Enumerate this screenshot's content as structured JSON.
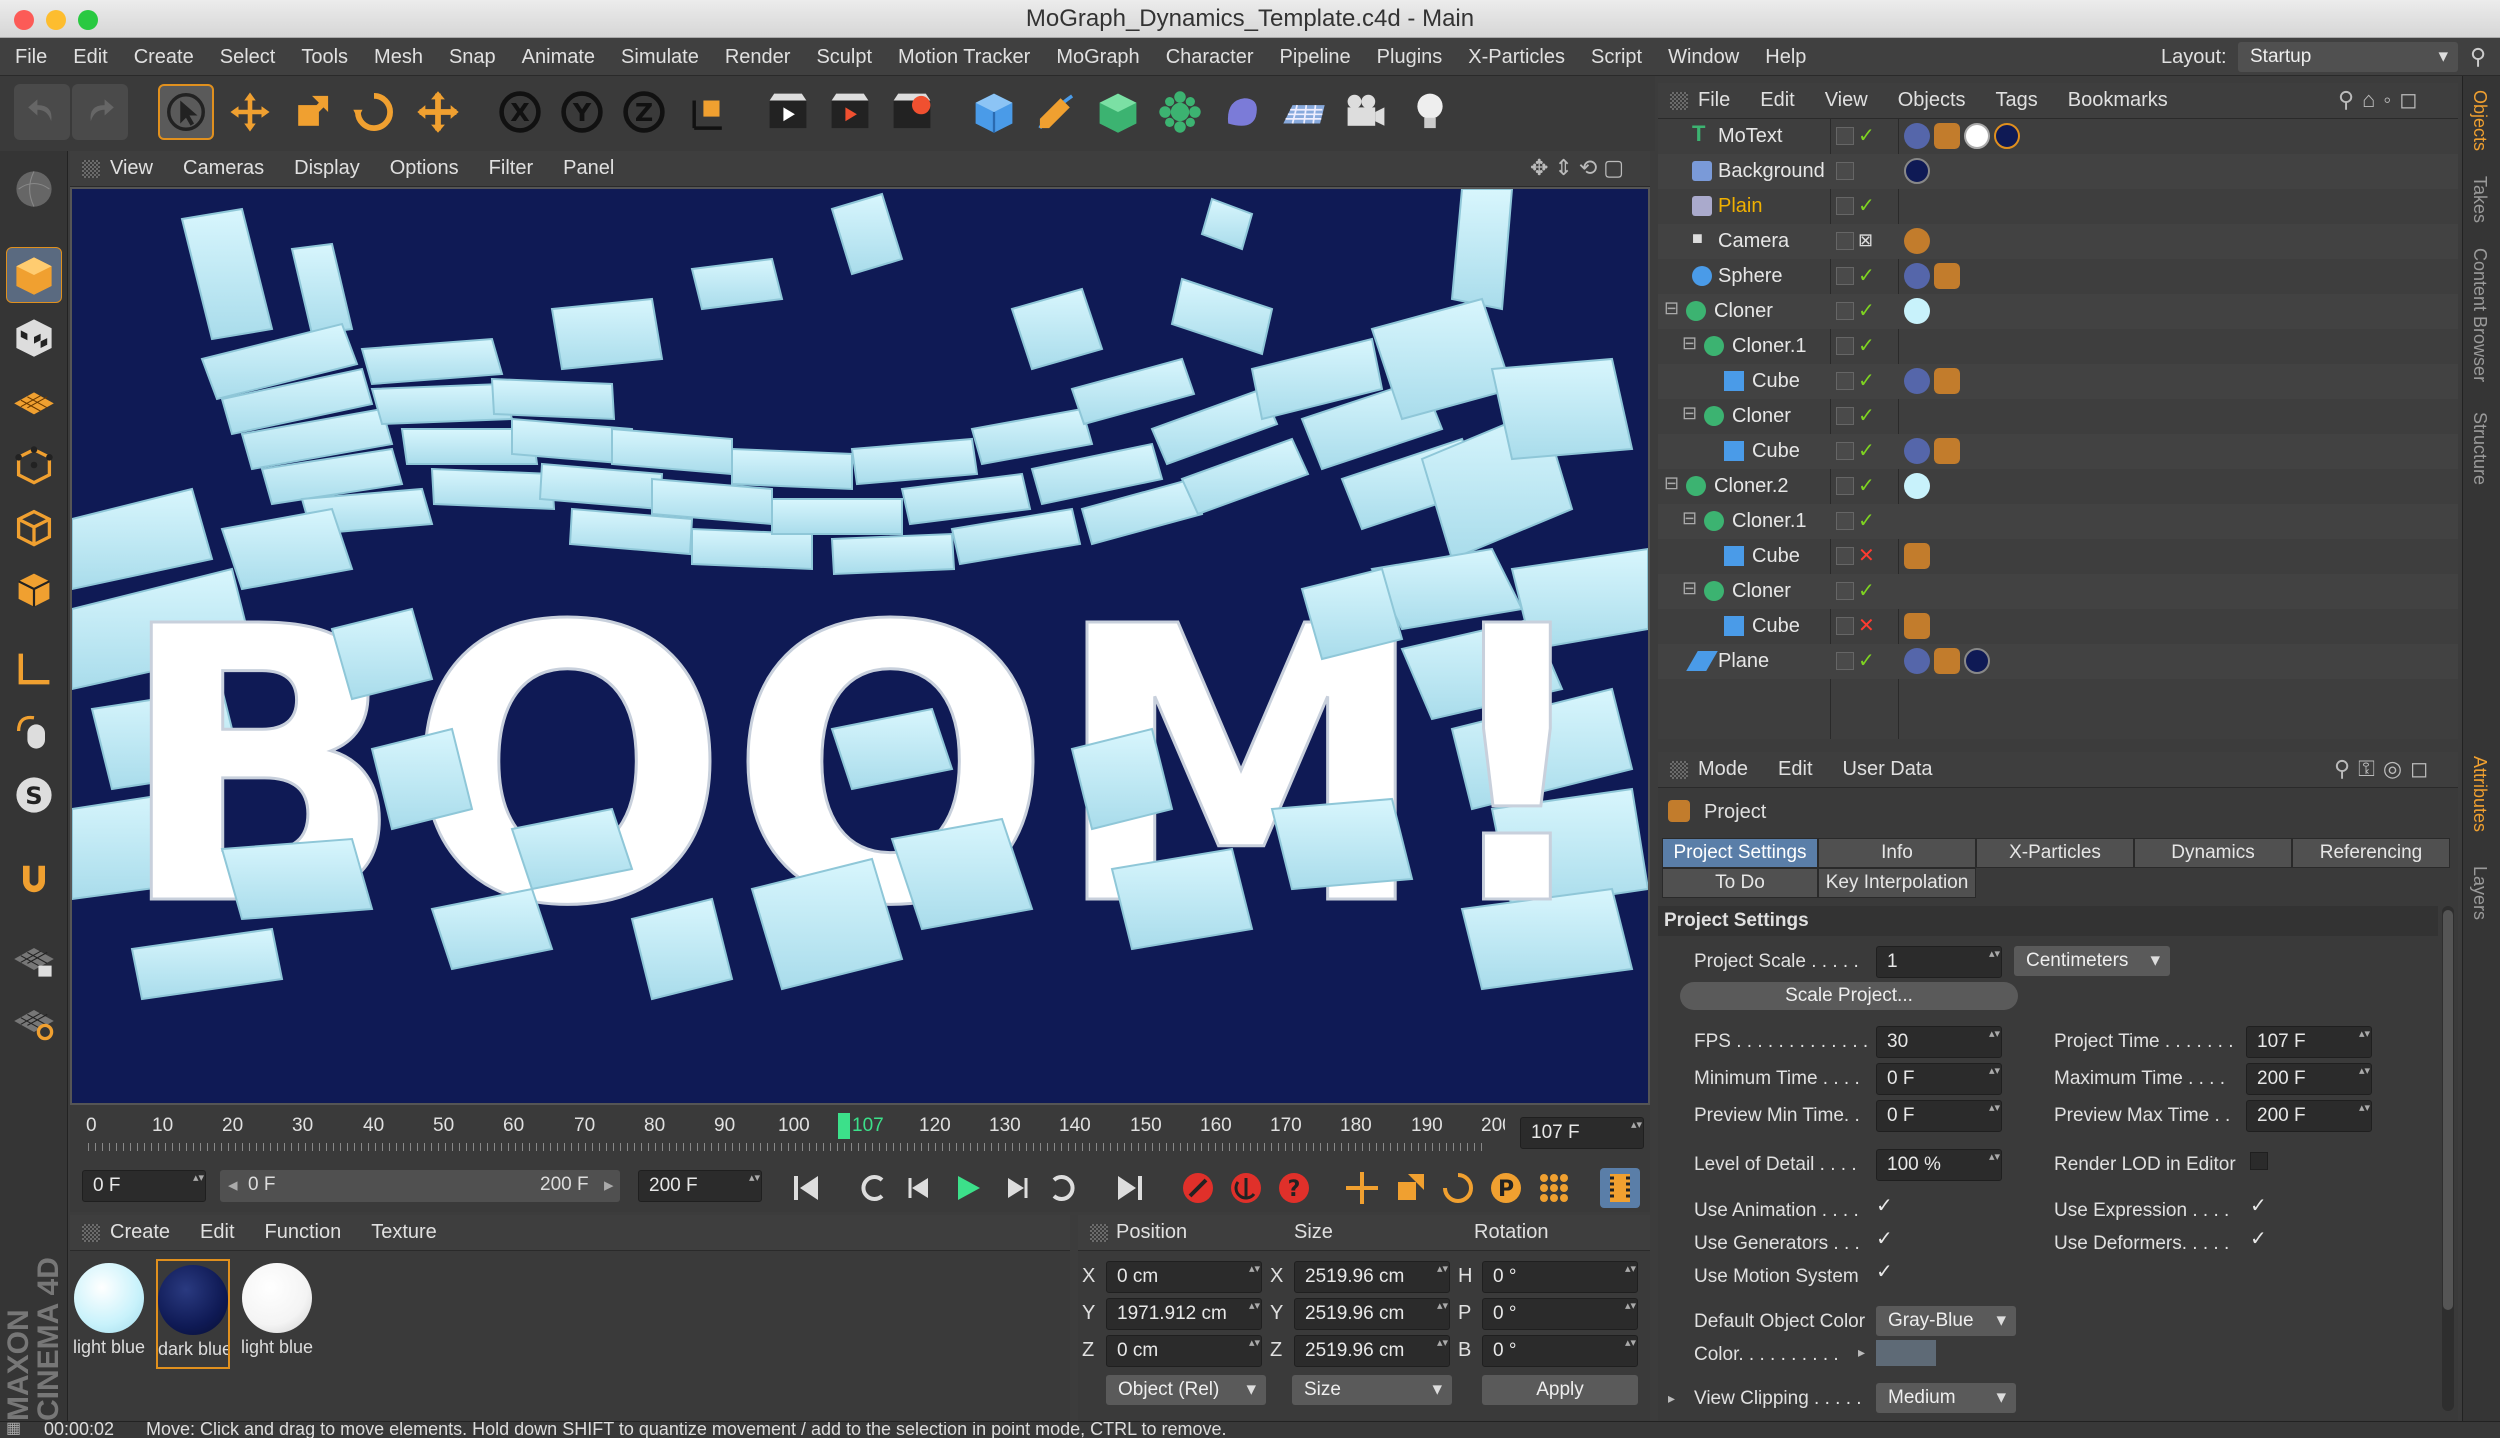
{
  "window": {
    "title": "MoGraph_Dynamics_Template.c4d - Main"
  },
  "menubar": {
    "items": [
      "File",
      "Edit",
      "Create",
      "Select",
      "Tools",
      "Mesh",
      "Snap",
      "Animate",
      "Simulate",
      "Render",
      "Sculpt",
      "Motion Tracker",
      "MoGraph",
      "Character",
      "Pipeline",
      "Plugins",
      "X-Particles",
      "Script",
      "Window",
      "Help"
    ],
    "layout_label": "Layout:",
    "layout_value": "Startup"
  },
  "viewport": {
    "menu": [
      "View",
      "Cameras",
      "Display",
      "Options",
      "Filter",
      "Panel"
    ],
    "scene_text": "BOOM!",
    "colors": {
      "background": "#0f1a55",
      "blocks": "#c8f2fb",
      "text": "#ffffff"
    }
  },
  "timeline": {
    "ticks": [
      "0",
      "10",
      "20",
      "30",
      "40",
      "50",
      "60",
      "70",
      "80",
      "90",
      "100",
      "120",
      "130",
      "140",
      "150",
      "160",
      "170",
      "180",
      "190",
      "200"
    ],
    "current_frame": "107",
    "frame_field": "107 F",
    "start_field": "0 F",
    "range_start": "0 F",
    "range_end": "200 F",
    "end_field": "200 F"
  },
  "materials": {
    "menu": [
      "Create",
      "Edit",
      "Function",
      "Texture"
    ],
    "items": [
      {
        "label": "light blue",
        "color": "#c8f2fb"
      },
      {
        "label": "dark blue",
        "color": "#0f1a55"
      },
      {
        "label": "light blue",
        "color": "#ffffff"
      }
    ]
  },
  "coordinates": {
    "headers": {
      "position": "Position",
      "size": "Size",
      "rotation": "Rotation"
    },
    "rows": [
      {
        "axis": "X",
        "pos": "0 cm",
        "size_axis": "X",
        "size": "2519.96 cm",
        "rot_axis": "H",
        "rot": "0 °"
      },
      {
        "axis": "Y",
        "pos": "1971.912 cm",
        "size_axis": "Y",
        "size": "2519.96 cm",
        "rot_axis": "P",
        "rot": "0 °"
      },
      {
        "axis": "Z",
        "pos": "0 cm",
        "size_axis": "Z",
        "size": "2519.96 cm",
        "rot_axis": "B",
        "rot": "0 °"
      }
    ],
    "mode_dropdown": "Object (Rel)",
    "size_dropdown": "Size",
    "apply": "Apply"
  },
  "objects": {
    "menu": [
      "File",
      "Edit",
      "View",
      "Objects",
      "Tags",
      "Bookmarks"
    ],
    "rows": [
      {
        "name": "MoText",
        "check": "check"
      },
      {
        "name": "Background",
        "check": "none"
      },
      {
        "name": "Plain",
        "check": "check"
      },
      {
        "name": "Camera",
        "check": "none"
      },
      {
        "name": "Sphere",
        "check": "check"
      },
      {
        "name": "Cloner",
        "check": "check"
      },
      {
        "name": "Cloner.1",
        "check": "check"
      },
      {
        "name": "Cube",
        "check": "check"
      },
      {
        "name": "Cloner",
        "check": "check"
      },
      {
        "name": "Cube",
        "check": "check"
      },
      {
        "name": "Cloner.2",
        "check": "check"
      },
      {
        "name": "Cloner.1",
        "check": "check"
      },
      {
        "name": "Cube",
        "check": "x"
      },
      {
        "name": "Cloner",
        "check": "check"
      },
      {
        "name": "Cube",
        "check": "x"
      },
      {
        "name": "Plane",
        "check": "check"
      }
    ]
  },
  "attributes": {
    "menu": [
      "Mode",
      "Edit",
      "User Data"
    ],
    "object_label": "Project",
    "tabs_row1": [
      "Project Settings",
      "Info",
      "X-Particles",
      "Dynamics",
      "Referencing"
    ],
    "tabs_row2": [
      "To Do",
      "Key Interpolation"
    ],
    "section": "Project Settings",
    "project_scale_label": "Project Scale . . . . .",
    "project_scale": "1",
    "scale_unit": "Centimeters",
    "scale_project_button": "Scale Project...",
    "fps_label": "FPS . . . . . . . . . . . . .",
    "fps": "30",
    "project_time_label": "Project Time . . . . . . .",
    "project_time": "107 F",
    "min_time_label": "Minimum Time . . . .",
    "min_time": "0 F",
    "max_time_label": "Maximum Time . . . .",
    "max_time": "200 F",
    "prev_min_label": "Preview Min Time. .",
    "prev_min": "0 F",
    "prev_max_label": "Preview Max Time . .",
    "prev_max": "200 F",
    "lod_label": "Level of Detail . . . .",
    "lod": "100 %",
    "render_lod_label": "Render LOD in Editor",
    "use_animation": "Use Animation . . . .",
    "use_expression": "Use Expression . . . .",
    "use_generators": "Use Generators . . .",
    "use_deformers": "Use Deformers. . . . .",
    "use_motion": "Use Motion System",
    "default_color_label": "Default Object Color",
    "default_color": "Gray-Blue",
    "color_label": "Color. . . . . . . . . .",
    "view_clipping_label": "View Clipping . . . . .",
    "view_clipping": "Medium"
  },
  "right_tabs": [
    "Objects",
    "Takes",
    "Content Browser",
    "Structure",
    "Attributes",
    "Layers"
  ],
  "status": {
    "time": "00:00:02",
    "message": "Move: Click and drag to move elements. Hold down SHIFT to quantize movement / add to the selection in point mode, CTRL to remove."
  },
  "brand": "MAXON CINEMA 4D"
}
